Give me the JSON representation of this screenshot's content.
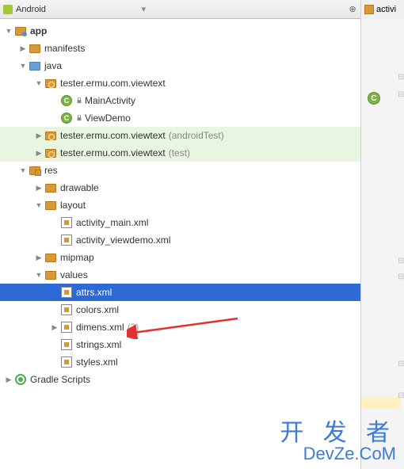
{
  "toolbar": {
    "view_mode": "Android",
    "tab_label": "activi"
  },
  "tree": {
    "app": "app",
    "manifests": "manifests",
    "java": "java",
    "pkg_main": "tester.ermu.com.viewtext",
    "main_activity": "MainActivity",
    "view_demo": "ViewDemo",
    "pkg_android_test": "tester.ermu.com.viewtext",
    "pkg_android_test_suffix": "(androidTest)",
    "pkg_test": "tester.ermu.com.viewtext",
    "pkg_test_suffix": "(test)",
    "res": "res",
    "drawable": "drawable",
    "layout": "layout",
    "activity_main": "activity_main.xml",
    "activity_viewdemo": "activity_viewdemo.xml",
    "mipmap": "mipmap",
    "values": "values",
    "attrs": "attrs.xml",
    "colors": "colors.xml",
    "dimens": "dimens.xml",
    "dimens_suffix": "(2)",
    "strings": "strings.xml",
    "styles": "styles.xml",
    "gradle": "Gradle Scripts"
  },
  "watermark": {
    "line1": "开 发 者",
    "line2": "DevZe.CoM"
  },
  "gutter": {
    "class_marker": "C",
    "green_color": "#4caf50"
  }
}
